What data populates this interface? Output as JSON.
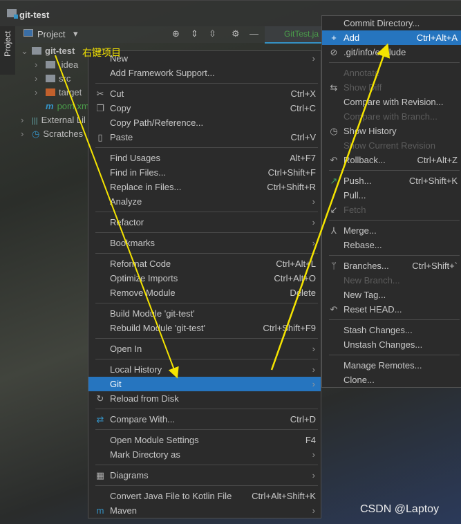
{
  "window": {
    "title": "git-test"
  },
  "toolwindow": {
    "side_label": "Project",
    "view_label": "Project",
    "editor_tab": "GitTest.ja"
  },
  "tree": [
    {
      "label": "git-test",
      "type": "module"
    },
    {
      "label": ".idea",
      "type": "folder"
    },
    {
      "label": "src",
      "type": "folder"
    },
    {
      "label": "target",
      "type": "folder-excluded"
    },
    {
      "label": "pom.xml",
      "type": "maven"
    },
    {
      "label": "External Lil",
      "type": "libraries"
    },
    {
      "label": "Scratches",
      "type": "scratches"
    }
  ],
  "annotation": "右键项目",
  "watermark": "CSDN @Laptoy",
  "context_menu": [
    {
      "label": "New",
      "submenu": true
    },
    {
      "label": "Add Framework Support..."
    },
    {
      "sep": true
    },
    {
      "label": "Cut",
      "shortcut": "Ctrl+X",
      "icon": "scissors-icon"
    },
    {
      "label": "Copy",
      "shortcut": "Ctrl+C",
      "icon": "copy-icon"
    },
    {
      "label": "Copy Path/Reference..."
    },
    {
      "label": "Paste",
      "shortcut": "Ctrl+V",
      "icon": "paste-icon"
    },
    {
      "sep": true
    },
    {
      "label": "Find Usages",
      "shortcut": "Alt+F7"
    },
    {
      "label": "Find in Files...",
      "shortcut": "Ctrl+Shift+F"
    },
    {
      "label": "Replace in Files...",
      "shortcut": "Ctrl+Shift+R"
    },
    {
      "label": "Analyze",
      "submenu": true
    },
    {
      "sep": true
    },
    {
      "label": "Refactor",
      "submenu": true
    },
    {
      "sep": true
    },
    {
      "label": "Bookmarks",
      "submenu": true
    },
    {
      "sep": true
    },
    {
      "label": "Reformat Code",
      "shortcut": "Ctrl+Alt+L"
    },
    {
      "label": "Optimize Imports",
      "shortcut": "Ctrl+Alt+O"
    },
    {
      "label": "Remove Module",
      "shortcut": "Delete"
    },
    {
      "sep": true
    },
    {
      "label": "Build Module 'git-test'"
    },
    {
      "label": "Rebuild Module 'git-test'",
      "shortcut": "Ctrl+Shift+F9"
    },
    {
      "sep": true
    },
    {
      "label": "Open In",
      "submenu": true
    },
    {
      "sep": true
    },
    {
      "label": "Local History",
      "submenu": true
    },
    {
      "label": "Git",
      "submenu": true,
      "selected": true
    },
    {
      "label": "Reload from Disk",
      "icon": "reload-icon"
    },
    {
      "sep": true
    },
    {
      "label": "Compare With...",
      "shortcut": "Ctrl+D",
      "icon": "compare-icon"
    },
    {
      "sep": true
    },
    {
      "label": "Open Module Settings",
      "shortcut": "F4"
    },
    {
      "label": "Mark Directory as",
      "submenu": true
    },
    {
      "sep": true
    },
    {
      "label": "Diagrams",
      "submenu": true,
      "icon": "diagram-icon"
    },
    {
      "sep": true
    },
    {
      "label": "Convert Java File to Kotlin File",
      "shortcut": "Ctrl+Alt+Shift+K"
    },
    {
      "label": "Maven",
      "submenu": true,
      "icon": "maven-icon"
    }
  ],
  "git_submenu": [
    {
      "label": "Commit Directory..."
    },
    {
      "label": "Add",
      "shortcut": "Ctrl+Alt+A",
      "icon": "plus-icon",
      "selected": true
    },
    {
      "label": ".git/info/exclude",
      "icon": "ignore-file-icon"
    },
    {
      "sep": true
    },
    {
      "label": "Annotate",
      "disabled": true
    },
    {
      "label": "Show Diff",
      "disabled": true,
      "icon": "diff-icon"
    },
    {
      "label": "Compare with Revision..."
    },
    {
      "label": "Compare with Branch...",
      "disabled": true
    },
    {
      "label": "Show History",
      "icon": "clock-icon"
    },
    {
      "label": "Show Current Revision",
      "disabled": true
    },
    {
      "label": "Rollback...",
      "shortcut": "Ctrl+Alt+Z",
      "icon": "undo-icon"
    },
    {
      "sep": true
    },
    {
      "label": "Push...",
      "shortcut": "Ctrl+Shift+K",
      "icon": "push-icon"
    },
    {
      "label": "Pull..."
    },
    {
      "label": "Fetch",
      "disabled": true,
      "icon": "fetch-icon"
    },
    {
      "sep": true
    },
    {
      "label": "Merge...",
      "icon": "merge-icon"
    },
    {
      "label": "Rebase..."
    },
    {
      "sep": true
    },
    {
      "label": "Branches...",
      "shortcut": "Ctrl+Shift+`",
      "icon": "branch-icon"
    },
    {
      "label": "New Branch...",
      "disabled": true
    },
    {
      "label": "New Tag..."
    },
    {
      "label": "Reset HEAD...",
      "icon": "undo-icon"
    },
    {
      "sep": true
    },
    {
      "label": "Stash Changes..."
    },
    {
      "label": "Unstash Changes..."
    },
    {
      "sep": true
    },
    {
      "label": "Manage Remotes..."
    },
    {
      "label": "Clone..."
    }
  ],
  "colors": {
    "selection": "#2675bf",
    "menu_bg": "#2b2b2b",
    "annotation": "#f5e400"
  }
}
